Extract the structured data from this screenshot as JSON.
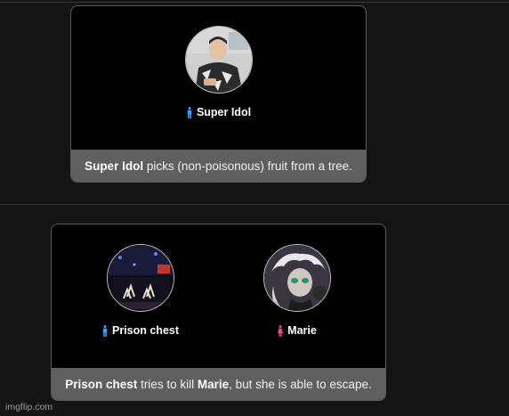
{
  "events": [
    {
      "tributes": [
        {
          "name": "Super Idol",
          "gender": "male",
          "gender_color": "#2fa7ff",
          "gender_icon": "male-person-icon"
        }
      ],
      "description": {
        "actor": "Super Idol",
        "text_after_actor": " picks (non-poisonous) fruit from a tree."
      }
    },
    {
      "tributes": [
        {
          "name": "Prison chest",
          "gender": "male",
          "gender_color": "#2fa7ff",
          "gender_icon": "male-person-icon"
        },
        {
          "name": "Marie",
          "gender": "female",
          "gender_color": "#ff3d9a",
          "gender_icon": "female-person-icon"
        }
      ],
      "description": {
        "actor": "Prison chest",
        "text_middle": " tries to kill ",
        "target": "Marie",
        "text_end": ", but she is able to escape."
      }
    }
  ],
  "watermark": "imgflip.com"
}
